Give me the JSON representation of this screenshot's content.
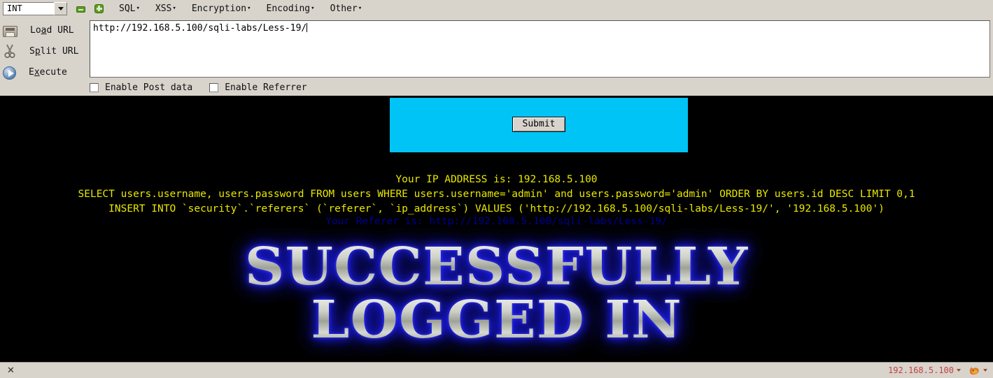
{
  "toolbar": {
    "mode_select_value": "INT",
    "icons": {
      "minus": "minus-icon",
      "plus": "plus-icon",
      "caret": "chevron-down-icon"
    },
    "menus": [
      {
        "label": "SQL",
        "caret": "▾"
      },
      {
        "label": "XSS",
        "caret": "▾"
      },
      {
        "label": "Encryption",
        "caret": "▾"
      },
      {
        "label": "Encoding",
        "caret": "▾"
      },
      {
        "label": "Other",
        "caret": "▾"
      }
    ]
  },
  "actions": [
    {
      "label_pre": "Lo",
      "label_key": "a",
      "label_post": "d URL",
      "icon": "load-url-icon"
    },
    {
      "label_pre": "S",
      "label_key": "p",
      "label_post": "lit URL",
      "icon": "scissors-icon"
    },
    {
      "label_pre": "E",
      "label_key": "x",
      "label_post": "ecute",
      "icon": "execute-play-icon"
    }
  ],
  "url_field": {
    "value": "http://192.168.5.100/sqli-labs/Less-19/"
  },
  "checkboxes": [
    {
      "label": "Enable Post data",
      "checked": false
    },
    {
      "label": "Enable Referrer",
      "checked": false
    }
  ],
  "page": {
    "submit_label": "Submit",
    "ip_line": "Your IP ADDRESS is: 192.168.5.100",
    "select_line": "SELECT users.username, users.password FROM users WHERE users.username='admin' and users.password='admin' ORDER BY users.id DESC LIMIT 0,1",
    "insert_line": "INSERT INTO `security`.`referers` (`referer`, `ip_address`) VALUES ('http://192.168.5.100/sqli-labs/Less-19/', '192.168.5.100')",
    "referer_line": "Your Referer is: http://192.168.5.100/sqli-labs/Less-19/",
    "banner_line1": "SUCCESSFULLY",
    "banner_line2": "LOGGED IN"
  },
  "statusbar": {
    "close_glyph": "✕",
    "ip": "192.168.5.100",
    "fox_icon": "firefox-fox-icon"
  },
  "colors": {
    "chrome": "#d8d4cc",
    "panel_cyan": "#00c4f5",
    "sql_yellow": "#e8e800",
    "referer_blue": "#00008f",
    "status_ip_red": "#c94040",
    "banner_glow": "#2020f0"
  }
}
